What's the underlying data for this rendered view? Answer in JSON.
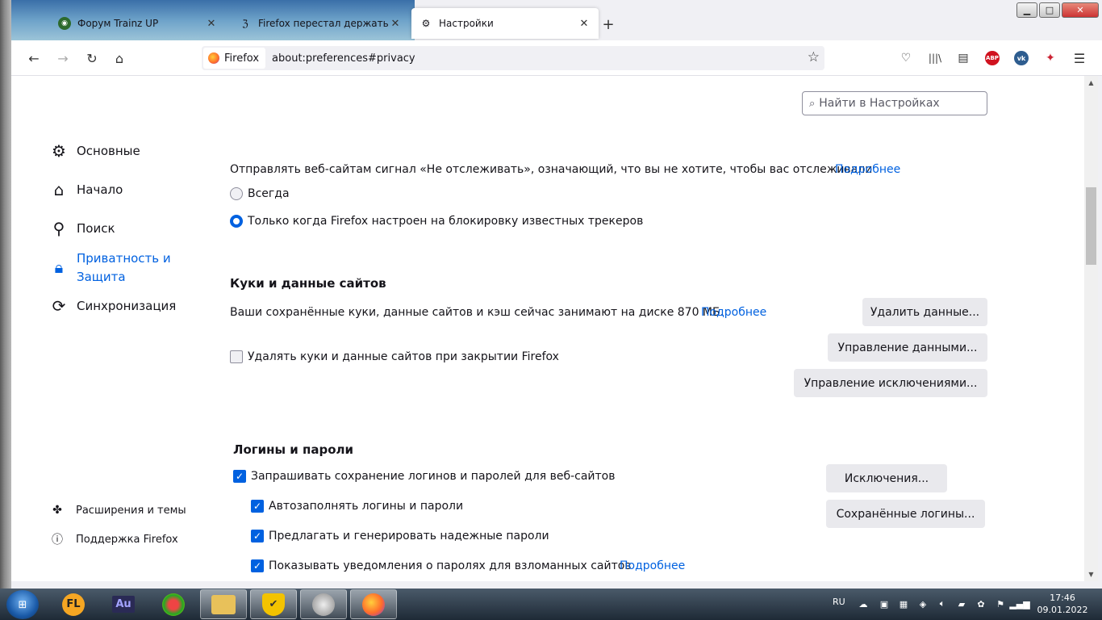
{
  "tabs": [
    {
      "title": "Форум Trainz UP",
      "icon": "trainz-icon"
    },
    {
      "title": "Firefox перестал держать автор",
      "icon": "forum-icon"
    },
    {
      "title": "Настройки",
      "icon": "gear-icon",
      "active": true
    }
  ],
  "window_controls": {
    "minimize": "▁",
    "maximize": "□",
    "close": "✕"
  },
  "navbar": {
    "identity_label": "Firefox",
    "url": "about:preferences#privacy"
  },
  "search": {
    "placeholder": "Найти в Настройках"
  },
  "categories": [
    {
      "label": "Основные",
      "icon": "gear-icon"
    },
    {
      "label": "Начало",
      "icon": "home-icon"
    },
    {
      "label": "Поиск",
      "icon": "search-icon"
    },
    {
      "label": "Приватность и Защита",
      "icon": "lock-icon",
      "selected": true
    },
    {
      "label": "Синхронизация",
      "icon": "sync-icon"
    }
  ],
  "footer_links": [
    {
      "label": "Расширения и темы",
      "icon": "puzzle-icon"
    },
    {
      "label": "Поддержка Firefox",
      "icon": "help-icon"
    }
  ],
  "dnt": {
    "text": "Отправлять веб-сайтам сигнал «Не отслеживать», означающий, что вы не хотите, чтобы вас отслеживали",
    "learn_more": "Подробнее",
    "option_always": "Всегда",
    "option_only_when": "Только когда Firefox настроен на блокировку известных трекеров",
    "selected": "only_when"
  },
  "cookies": {
    "heading": "Куки и данные сайтов",
    "usage_text": "Ваши сохранённые куки, данные сайтов и кэш сейчас занимают на диске 870 МБ.",
    "learn_more": "Подробнее",
    "delete_on_close_label": "Удалять куки и данные сайтов при закрытии Firefox",
    "delete_on_close_checked": false,
    "clear_data_button": "Удалить данные...",
    "manage_data_button": "Управление данными...",
    "manage_exceptions_button": "Управление исключениями..."
  },
  "logins": {
    "heading": "Логины и пароли",
    "ask_to_save_label": "Запрашивать сохранение логинов и паролей для веб-сайтов",
    "autofill_label": "Автозаполнять логины и пароли",
    "suggest_passwords_label": "Предлагать и генерировать надежные пароли",
    "breach_alerts_label": "Показывать уведомления о паролях для взломанных сайтов",
    "learn_more": "Подробнее",
    "exceptions_button": "Исключения...",
    "saved_logins_button": "Сохранённые логины...",
    "ask_to_save_checked": true,
    "autofill_checked": true,
    "suggest_checked": true,
    "breach_checked": true
  },
  "taskbar": {
    "apps": [
      "fl-studio-icon",
      "audition-icon",
      "browser-icon",
      "explorer-icon",
      "shield-icon",
      "speaker-icon",
      "firefox-icon"
    ],
    "audition_label": "Au",
    "language": "RU",
    "time": "17:46",
    "date": "09.01.2022"
  },
  "colors": {
    "accent": "#0061e0",
    "button_bg": "#e9e9ed"
  }
}
